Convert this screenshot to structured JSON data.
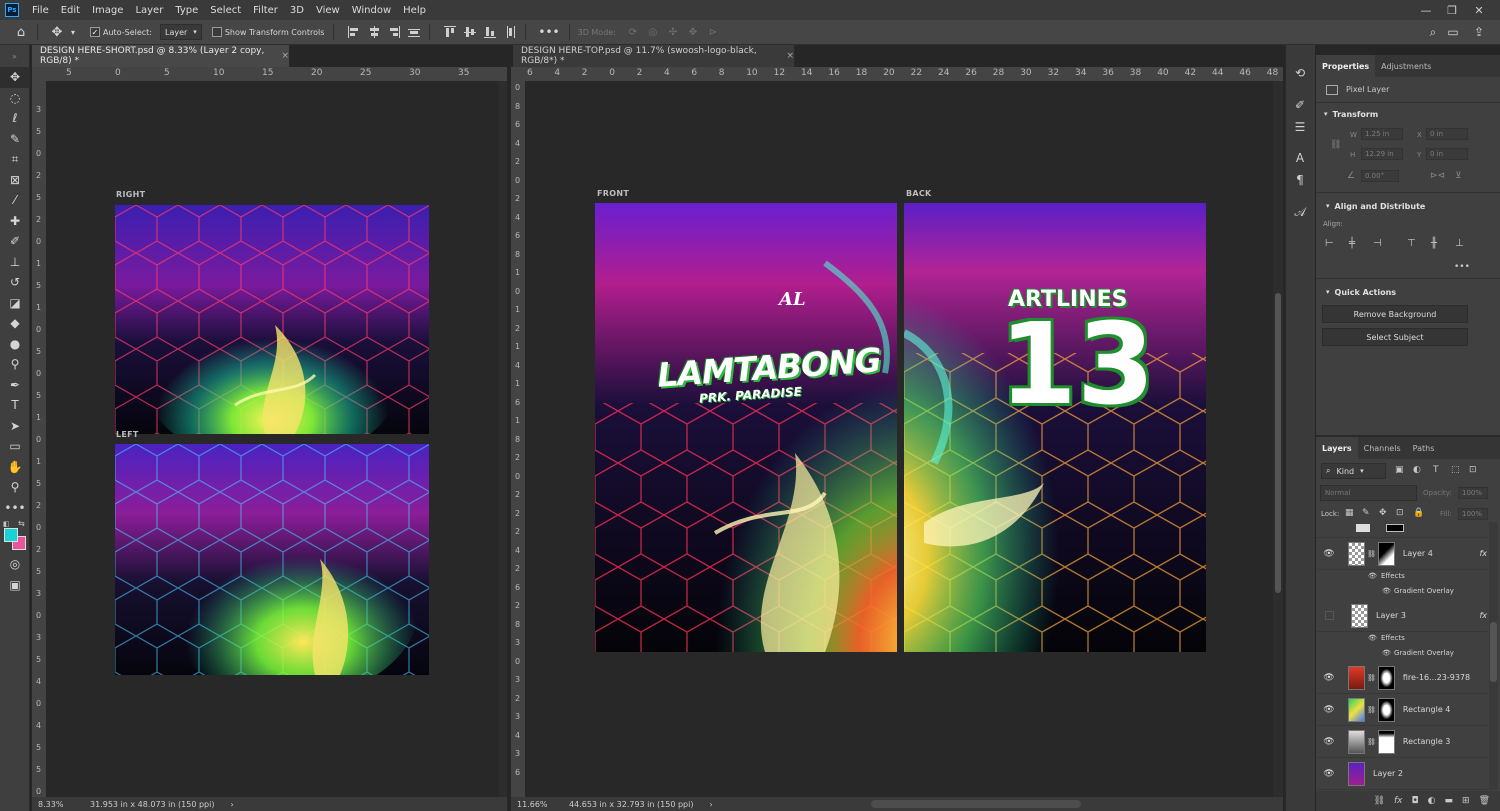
{
  "app_icon": "Ps",
  "menu": [
    "File",
    "Edit",
    "Image",
    "Layer",
    "Type",
    "Select",
    "Filter",
    "3D",
    "View",
    "Window",
    "Help"
  ],
  "options": {
    "auto_select_label": "Auto-Select:",
    "auto_select_value": "Layer",
    "show_transform_label": "Show Transform Controls",
    "mode_3d_label": "3D Mode:",
    "more": "•••"
  },
  "documents": {
    "left": {
      "tab_title": "DESIGN HERE-SHORT.psd @ 8.33% (Layer 2 copy, RGB/8) *",
      "close": "×",
      "ruler_h": [
        "5",
        "0",
        "5",
        "10",
        "15",
        "20",
        "25",
        "30",
        "35"
      ],
      "ruler_v": [
        "3",
        "5",
        "0",
        "2",
        "5",
        "2",
        "0",
        "1",
        "5",
        "1",
        "0",
        "5",
        "0",
        "5",
        "1",
        "0",
        "1",
        "5",
        "2",
        "0",
        "2",
        "5",
        "3",
        "0",
        "3",
        "5",
        "4",
        "0",
        "4",
        "5",
        "5",
        "0"
      ],
      "artboard_right_label": "RIGHT",
      "artboard_left_label": "LEFT",
      "status_zoom": "8.33%",
      "status_size": "31.953 in x 48.073 in (150 ppi)",
      "status_arrow": "›"
    },
    "right": {
      "tab_title": "DESIGN HERE-TOP.psd @ 11.7% (swoosh-logo-black, RGB/8*) *",
      "close": "×",
      "ruler_h": [
        "6",
        "4",
        "2",
        "0",
        "2",
        "4",
        "6",
        "8",
        "10",
        "12",
        "14",
        "16",
        "18",
        "20",
        "22",
        "24",
        "26",
        "28",
        "30",
        "32",
        "34",
        "36",
        "38",
        "40",
        "42",
        "44",
        "46",
        "48"
      ],
      "ruler_v": [
        "0",
        "8",
        "6",
        "4",
        "2",
        "0",
        "2",
        "4",
        "6",
        "8",
        "1",
        "0",
        "1",
        "2",
        "1",
        "4",
        "1",
        "6",
        "1",
        "8",
        "2",
        "0",
        "2",
        "2",
        "2",
        "4",
        "2",
        "6",
        "2",
        "8",
        "3",
        "0",
        "3",
        "2",
        "3",
        "4",
        "3",
        "6"
      ],
      "artboard_front_label": "FRONT",
      "artboard_back_label": "BACK",
      "logo_mark": "AL",
      "front_title": "LAMTABONG",
      "front_subtitle": "PRK. PARADISE",
      "back_name": "ARTLINES",
      "back_number": "13",
      "status_zoom": "11.66%",
      "status_size": "44.653 in x 32.793 in (150 ppi)",
      "status_arrow": "›"
    }
  },
  "properties_panel": {
    "tabs": [
      "Properties",
      "Adjustments"
    ],
    "layer_type": "Pixel Layer",
    "transform_title": "Transform",
    "w_label": "W",
    "w_value": "1.25 in",
    "h_label": "H",
    "h_value": "12.29 in",
    "x_label": "X",
    "x_value": "0 in",
    "y_label": "Y",
    "y_value": "0 in",
    "angle_value": "0.00°",
    "align_title": "Align and Distribute",
    "align_label": "Align:",
    "more": "•••",
    "quick_actions_title": "Quick Actions",
    "remove_bg_label": "Remove Background",
    "select_subject_label": "Select Subject"
  },
  "layers_panel": {
    "tabs": [
      "Layers",
      "Channels",
      "Paths"
    ],
    "kind_label": "Kind",
    "blend_mode": "Normal",
    "opacity_label": "Opacity:",
    "opacity_value": "100%",
    "lock_label": "Lock:",
    "fill_label": "Fill:",
    "fill_value": "100%",
    "layers": [
      {
        "name": "Layer 4",
        "fx": "fx",
        "visible": true
      },
      {
        "name": "Effects",
        "sub": true
      },
      {
        "name": "Gradient Overlay",
        "sub2": true
      },
      {
        "name": "Layer 3",
        "fx": "fx",
        "visible": false
      },
      {
        "name": "Effects",
        "sub": true
      },
      {
        "name": "Gradient Overlay",
        "sub2": true
      },
      {
        "name": "fire-16...23-9378",
        "visible": true
      },
      {
        "name": "Rectangle 4",
        "visible": true
      },
      {
        "name": "Rectangle 3",
        "visible": true
      },
      {
        "name": "Layer 2",
        "visible": true
      }
    ],
    "footer_fx": "fx"
  },
  "colors": {
    "foreground": "#19d2d8",
    "background": "#e8559a"
  }
}
